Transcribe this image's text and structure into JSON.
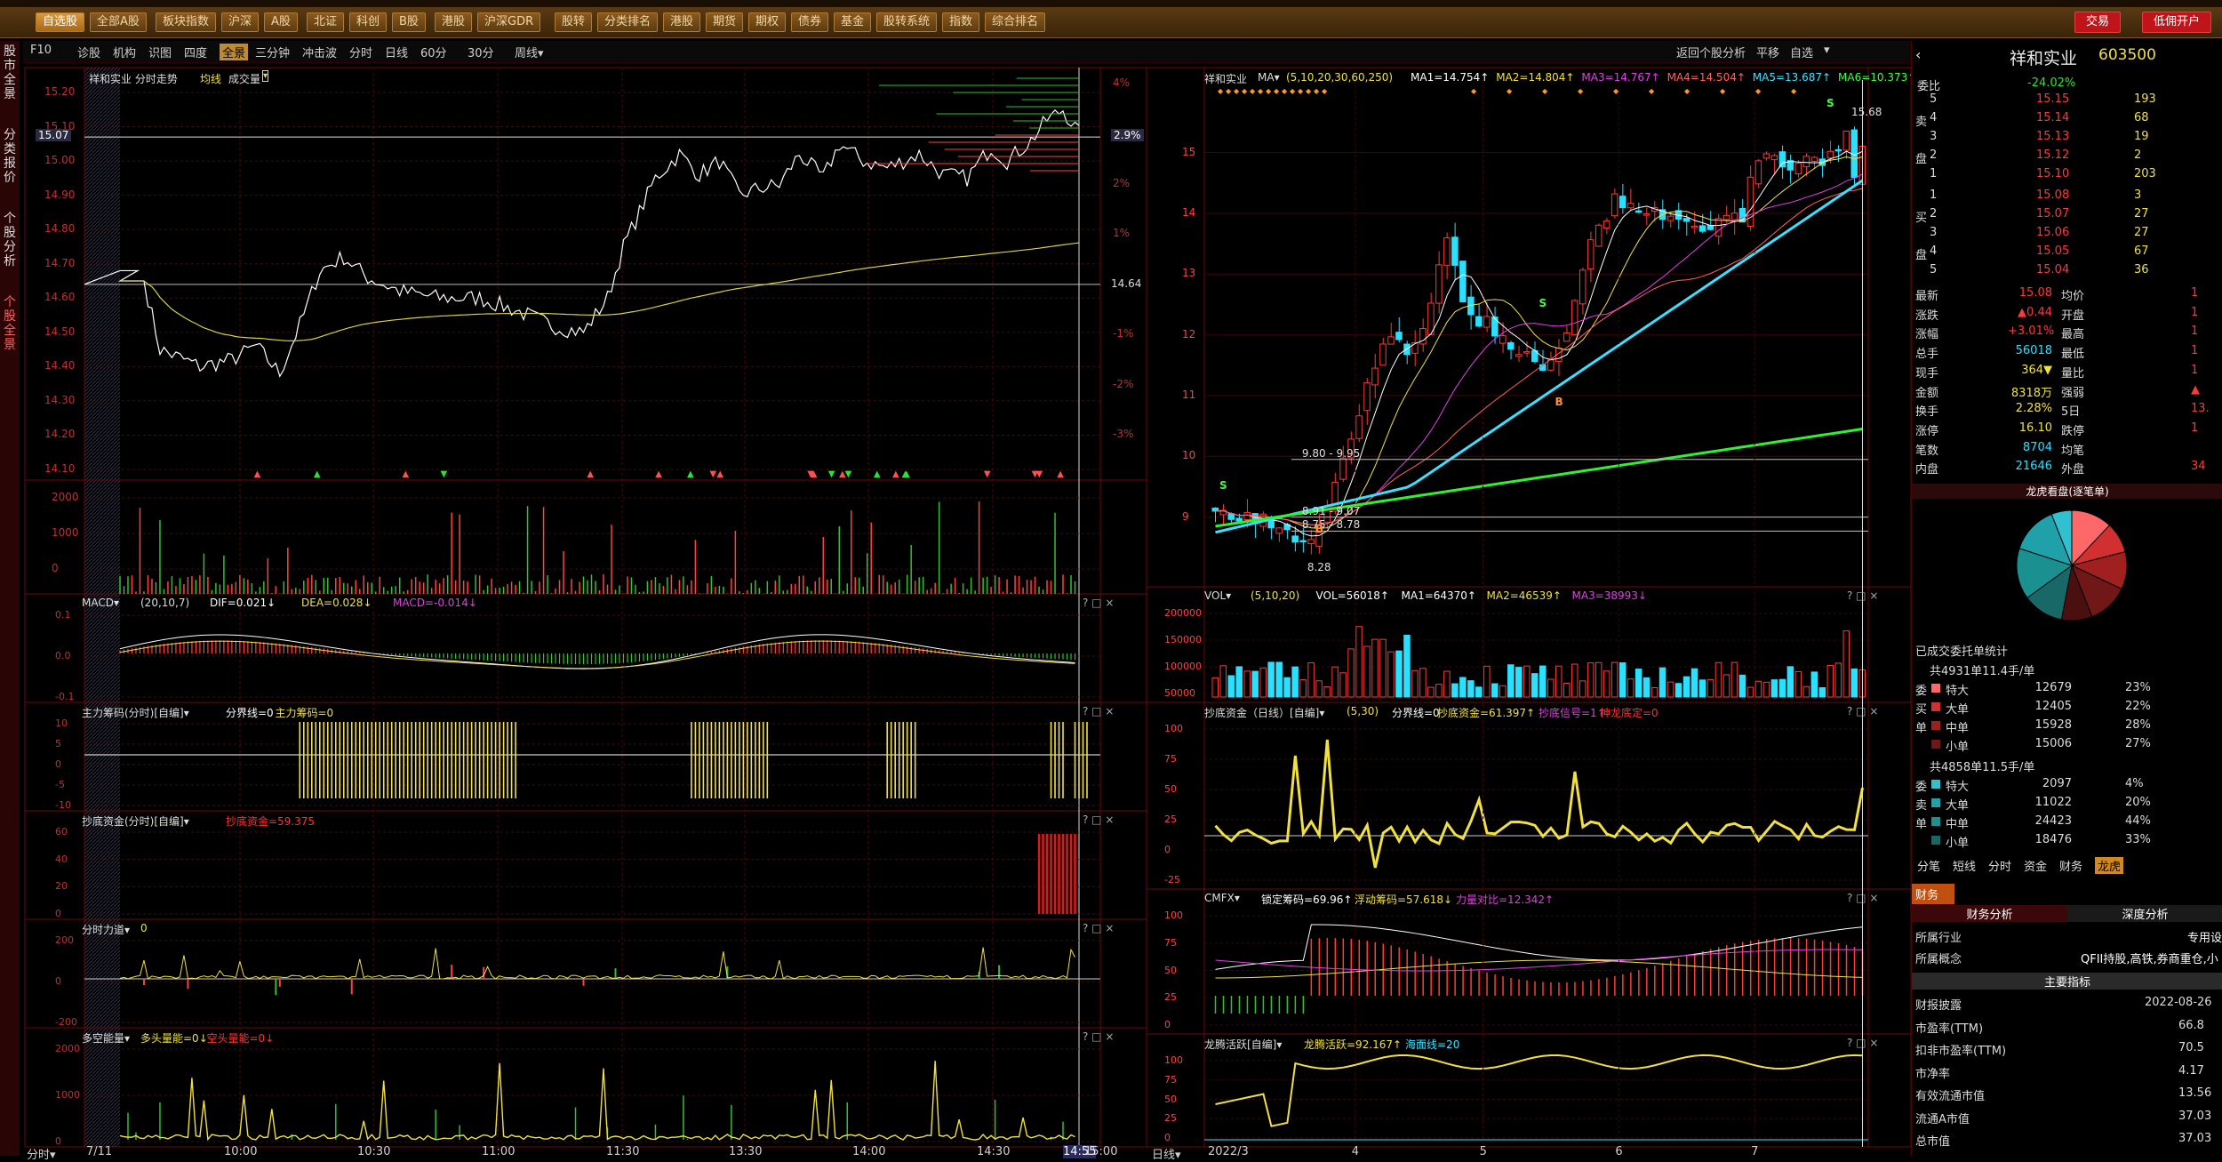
{
  "top_menu": {
    "items": [
      "自选股",
      "全部A股",
      "板块指数",
      "沪深",
      "A股",
      "北证",
      "科创",
      "B股",
      "港股",
      "沪深GDR",
      "股转",
      "分类排名",
      "港股",
      "期货",
      "期权",
      "债券",
      "基金",
      "股转系统",
      "指数",
      "综合排名"
    ],
    "active_index": 0,
    "trade_button": "交易",
    "open_account_button": "低佣开户"
  },
  "toolbar": {
    "left": [
      "F10",
      "诊股",
      "机构",
      "识图",
      "四度",
      "全景",
      "三分钟",
      "冲击波",
      "分时",
      "日线",
      "60分",
      "30分",
      "周线▾"
    ],
    "selected_index": 5,
    "right": [
      "返回个股分析",
      "平移",
      "自选",
      "▾"
    ]
  },
  "left_tabs": [
    "股市全景",
    "分类报价",
    "个股分析",
    "个股全景"
  ],
  "intraday": {
    "title": "祥和实业  分时走势",
    "avg_label": "均线",
    "vol_label": "成交量",
    "price_axis": [
      "15.20",
      "15.10",
      "15.00",
      "14.90",
      "14.80",
      "14.70",
      "14.60",
      "14.50",
      "14.40",
      "14.30",
      "14.20",
      "14.10"
    ],
    "cursor_price": "15.07",
    "pct_axis": [
      "4%",
      "3%",
      "2%",
      "1%",
      "-1%",
      "-2%",
      "-3%"
    ],
    "cursor_pct": "2.9%",
    "ref_price": "14.64",
    "vol_axis": [
      "2000",
      "1000",
      "0"
    ],
    "time_axis": [
      "7/11",
      "10:00",
      "10:30",
      "11:00",
      "11:30",
      "13:30",
      "14:00",
      "14:30",
      "14:55",
      "15:00"
    ],
    "bottom_left": "分时▾"
  },
  "ind_panels": [
    {
      "id": "macd",
      "title": "MACD▾",
      "params": "(20,10,7)",
      "vals": [
        {
          "t": "DIF=0.021↓",
          "c": "#ffffff"
        },
        {
          "t": "DEA=0.028↓",
          "c": "#f0e040"
        },
        {
          "t": "MACD=-0.014↓",
          "c": "#e040e0"
        }
      ],
      "axis": [
        "0.1",
        "0.0",
        "-0.1"
      ]
    },
    {
      "id": "zlcm",
      "title": "主力筹码(分时)[自编]▾",
      "params": "",
      "vals": [
        {
          "t": "分界线=0",
          "c": "#ffffff"
        },
        {
          "t": "主力筹码=0",
          "c": "#f0e040"
        }
      ],
      "axis": [
        "10",
        "5",
        "0",
        "-5",
        "-10"
      ]
    },
    {
      "id": "cdzj",
      "title": "抄底资金(分时)[自编]▾",
      "params": "",
      "vals": [
        {
          "t": "抄底资金=59.375",
          "c": "#ff3030"
        }
      ],
      "axis": [
        "60",
        "40",
        "20",
        "0"
      ]
    },
    {
      "id": "fsld",
      "title": "分时力道▾",
      "params": "",
      "vals": [
        {
          "t": "0",
          "c": "#f0e040"
        }
      ],
      "axis": [
        "200",
        "0",
        "-200"
      ]
    },
    {
      "id": "dknl",
      "title": "多空能量▾",
      "params": "",
      "vals": [
        {
          "t": "多头量能=0↓",
          "c": "#f0e040"
        },
        {
          "t": "空头量能=0↓",
          "c": "#ff3030"
        }
      ],
      "axis": [
        "2000",
        "1000",
        "0"
      ]
    }
  ],
  "kline": {
    "title": "祥和实业",
    "ma_label": "MA▾",
    "ma_params": "(5,10,20,30,60,250)",
    "ma_vals": [
      {
        "t": "MA1=14.754↑",
        "c": "#ffffff"
      },
      {
        "t": "MA2=14.804↑",
        "c": "#f0e040"
      },
      {
        "t": "MA3=14.767↑",
        "c": "#e040e0"
      },
      {
        "t": "MA4=14.504↑",
        "c": "#ff6060"
      },
      {
        "t": "MA5=13.687↑",
        "c": "#40e0ff"
      },
      {
        "t": "MA6=10.373↑",
        "c": "#40ff40"
      }
    ],
    "price_axis": [
      "15",
      "14",
      "13",
      "12",
      "11",
      "10",
      "9"
    ],
    "labels": {
      "high": "15.68",
      "low": "8.28",
      "r1": "9.80 - 9.95",
      "r2": "8.91 - 9.07",
      "r3": "8.75 - 8.78",
      "b1": "B",
      "b2": "B",
      "s1": "S",
      "s2": "S",
      "s3": "S"
    },
    "date_axis": [
      "2022/3",
      "4",
      "5",
      "6",
      "7"
    ],
    "bottom_left": "日线▾"
  },
  "k_ind_panels": [
    {
      "id": "vol",
      "title": "VOL▾",
      "params": "(5,10,20)",
      "vals": [
        {
          "t": "VOL=56018↑",
          "c": "#ffffff"
        },
        {
          "t": "MA1=64370↑",
          "c": "#ffffff"
        },
        {
          "t": "MA2=46539↑",
          "c": "#f0e040"
        },
        {
          "t": "MA3=38993↓",
          "c": "#e040e0"
        }
      ],
      "axis": [
        "200000",
        "150000",
        "100000",
        "50000"
      ]
    },
    {
      "id": "cdzjd",
      "title": "抄底资金（日线）[自编]▾",
      "params": "(5,30)",
      "vals": [
        {
          "t": "分界线=0",
          "c": "#ffffff"
        },
        {
          "t": "抄底资金=61.397↑",
          "c": "#f0e040"
        },
        {
          "t": "抄底信号=1↑",
          "c": "#e040e0"
        },
        {
          "t": "神龙底定=0",
          "c": "#ff3030"
        }
      ],
      "axis": [
        "100",
        "75",
        "50",
        "25",
        "0",
        "-25"
      ]
    },
    {
      "id": "cmfx",
      "title": "CMFX▾",
      "params": "",
      "vals": [
        {
          "t": "锁定筹码=69.96↑",
          "c": "#ffffff"
        },
        {
          "t": "浮动筹码=57.618↓",
          "c": "#f0e040"
        },
        {
          "t": "力量对比=12.342↑",
          "c": "#e040e0"
        }
      ],
      "axis": [
        "100",
        "75",
        "50",
        "25",
        "0"
      ]
    },
    {
      "id": "lthy",
      "title": "龙腾活跃[自编]▾",
      "params": "",
      "vals": [
        {
          "t": "龙腾活跃=92.167↑",
          "c": "#f0e040"
        },
        {
          "t": "海面线=20",
          "c": "#40e0ff"
        }
      ],
      "axis": [
        "100",
        "75",
        "50",
        "25",
        "0"
      ]
    }
  ],
  "quote": {
    "name": "祥和实业",
    "code": "603500",
    "weibi_label": "委比",
    "weibi": "-24.02%",
    "sell": [
      {
        "label": "5",
        "price": "15.15",
        "vol": "193"
      },
      {
        "label": "4",
        "price": "15.14",
        "vol": "68"
      },
      {
        "label": "3",
        "price": "15.13",
        "vol": "19"
      },
      {
        "label": "2",
        "price": "15.12",
        "vol": "2"
      },
      {
        "label": "1",
        "price": "15.10",
        "vol": "203"
      }
    ],
    "buy": [
      {
        "label": "1",
        "price": "15.08",
        "vol": "3"
      },
      {
        "label": "2",
        "price": "15.07",
        "vol": "27"
      },
      {
        "label": "3",
        "price": "15.06",
        "vol": "27"
      },
      {
        "label": "4",
        "price": "15.05",
        "vol": "67"
      },
      {
        "label": "5",
        "price": "15.04",
        "vol": "36"
      }
    ],
    "side_labels": {
      "sell": "卖盘",
      "buy": "买盘"
    },
    "stats": [
      [
        "最新",
        "15.08",
        "均价",
        "1"
      ],
      [
        "涨跌",
        "▲0.44",
        "开盘",
        "1"
      ],
      [
        "涨幅",
        "+3.01%",
        "最高",
        "1"
      ],
      [
        "总手",
        "56018",
        "最低",
        "1"
      ],
      [
        "现手",
        "364▼",
        "量比",
        "1"
      ],
      [
        "金额",
        "8318万",
        "强弱",
        "▲"
      ],
      [
        "换手",
        "2.28%",
        "5日",
        "13."
      ],
      [
        "涨停",
        "16.10",
        "跌停",
        "1"
      ],
      [
        "笔数",
        "8704",
        "均笔",
        ""
      ],
      [
        "内盘",
        "21646",
        "外盘",
        "34"
      ]
    ],
    "pie_title": "龙虎看盘(逐笔单)",
    "pie_pct": [
      12,
      9,
      11,
      12,
      9,
      12,
      15,
      14,
      6
    ],
    "deal_title": "已成交委托单统计",
    "buy_summary": "共4931单11.4手/单",
    "buy_rows": [
      [
        "特大",
        "12679",
        "23%"
      ],
      [
        "大单",
        "12405",
        "22%"
      ],
      [
        "中单",
        "15928",
        "28%"
      ],
      [
        "小单",
        "15006",
        "27%"
      ]
    ],
    "buy_side": [
      "委",
      "买",
      "单"
    ],
    "sell_summary": "共4858单11.5手/单",
    "sell_rows": [
      [
        "特大",
        "2097",
        "4%"
      ],
      [
        "大单",
        "11022",
        "20%"
      ],
      [
        "中单",
        "24423",
        "44%"
      ],
      [
        "小单",
        "18476",
        "33%"
      ]
    ],
    "sell_side": [
      "委",
      "卖",
      "单"
    ],
    "tabs": [
      "分笔",
      "短线",
      "分时",
      "资金",
      "财务",
      "龙虎"
    ],
    "tabs_active": 5,
    "fin_header": "财务",
    "fin_tabs": [
      "财务分析",
      "深度分析"
    ],
    "fin_rows": [
      [
        "所属行业",
        "专用设"
      ],
      [
        "所属概念",
        "QFII持股,高铁,券商重仓,小"
      ]
    ],
    "main_index_title": "主要指标",
    "index_rows": [
      [
        "财报披露",
        "2022-08-26"
      ],
      [
        "市盈率(TTM)",
        "66.8"
      ],
      [
        "扣非市盈率(TTM)",
        "70.5"
      ],
      [
        "市净率",
        "4.17"
      ],
      [
        "有效流通市值",
        "13.56"
      ],
      [
        "流通A市值",
        "37.03"
      ],
      [
        "总市值",
        "37.03"
      ]
    ]
  },
  "colors": {
    "up": "#ff3838",
    "down": "#2ae0ff",
    "grid": "#6a0a0a",
    "yellow": "#f0e040"
  }
}
